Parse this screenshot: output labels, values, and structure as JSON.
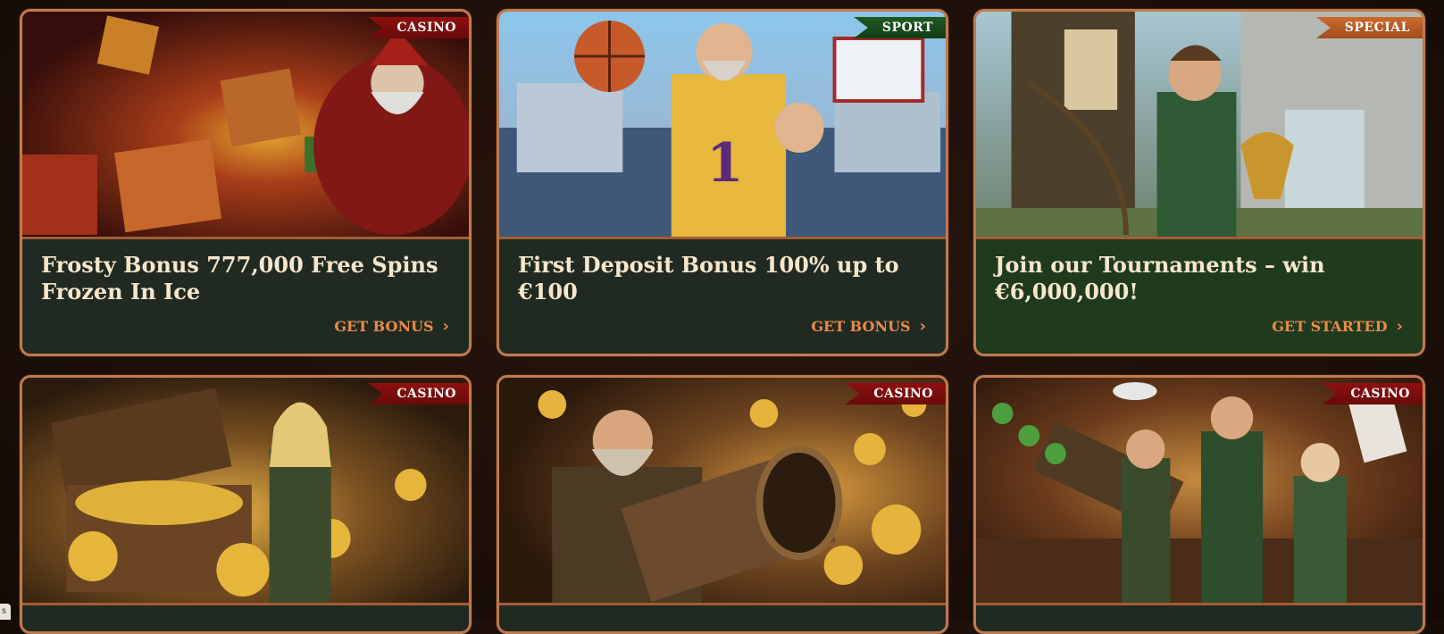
{
  "cards": [
    {
      "tag": "CASINO",
      "title": "Frosty Bonus 777,000 Free Spins Frozen In Ice",
      "cta": "GET BONUS",
      "image": "santa-with-gift-sack-art"
    },
    {
      "tag": "SPORT",
      "title": "First Deposit Bonus 100% up to €100",
      "cta": "GET BONUS",
      "image": "basketball-player-castle-art"
    },
    {
      "tag": "SPECIAL",
      "title": "Join our Tournaments – win €6,000,000!",
      "cta": "GET STARTED",
      "image": "archer-with-gold-trophy-art"
    },
    {
      "tag": "CASINO",
      "image": "treasure-chest-heroine-art"
    },
    {
      "tag": "CASINO",
      "image": "coin-cannon-dwarf-art"
    },
    {
      "tag": "CASINO",
      "image": "band-of-outlaws-cannon-art"
    }
  ],
  "side_tab": "s",
  "colors": {
    "border": "#c07a4d",
    "cta": "#e98a48",
    "casino": "#8e1010",
    "sport": "#1f5a22",
    "special": "#cc6a2e"
  }
}
